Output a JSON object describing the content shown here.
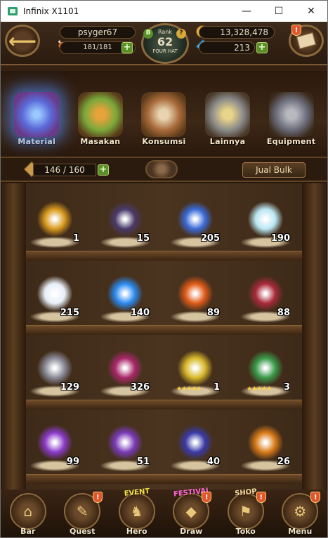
{
  "window": {
    "title": "Infinix X1101",
    "controls": [
      "—",
      "☐",
      "✕"
    ]
  },
  "hud": {
    "player_name": "psyger67",
    "stamina": "181/181",
    "rank_label": "Rank",
    "rank_value": "62",
    "rank_sub": "FOUR HAT",
    "gold": "13,328,478",
    "gems": "213",
    "mail_alert": "!"
  },
  "categories": [
    {
      "label": "Material",
      "active": true
    },
    {
      "label": "Masakan",
      "active": false
    },
    {
      "label": "Konsumsi",
      "active": false
    },
    {
      "label": "Lainnya",
      "active": false
    },
    {
      "label": "Equipment",
      "active": false
    }
  ],
  "capacity": {
    "value": "146 / 160",
    "bulk_sell_label": "Jual Bulk"
  },
  "items": [
    {
      "count": "1",
      "icon": "golden-orb-icon",
      "color": "#d99a1e"
    },
    {
      "count": "15",
      "icon": "dark-crystal-orb-icon",
      "color": "#4a3a6a"
    },
    {
      "count": "205",
      "icon": "potion-bottle-icon",
      "color": "#3a6ad8"
    },
    {
      "count": "190",
      "icon": "ice-crystal-icon",
      "color": "#b9e6f2"
    },
    {
      "count": "215",
      "icon": "white-crystal-icon",
      "color": "#e8eef8"
    },
    {
      "count": "140",
      "icon": "blue-flame-icon",
      "color": "#2a8af0"
    },
    {
      "count": "89",
      "icon": "fire-rune-icon",
      "color": "#e05a18"
    },
    {
      "count": "88",
      "icon": "red-crystal-shard-icon",
      "color": "#a82a3a"
    },
    {
      "count": "129",
      "icon": "grey-claw-icon",
      "color": "#8a8a98"
    },
    {
      "count": "326",
      "icon": "pink-horn-icon",
      "color": "#a8286a"
    },
    {
      "count": "1",
      "icon": "gold-tarot-card-icon",
      "color": "#d8b82a",
      "stars": "★★★★★"
    },
    {
      "count": "3",
      "icon": "green-tarot-card-icon",
      "color": "#3a9a4a",
      "stars": "★★★★★"
    },
    {
      "count": "99",
      "icon": "purple-mushroom-icon",
      "color": "#8a3ac8"
    },
    {
      "count": "51",
      "icon": "purple-mushroom-icon",
      "color": "#7a3ab8"
    },
    {
      "count": "40",
      "icon": "blue-shield-icon",
      "color": "#3a3aa8"
    },
    {
      "count": "26",
      "icon": "orange-shield-icon",
      "color": "#d87a18"
    }
  ],
  "nav": [
    {
      "label": "Bar",
      "icon": "bar-icon",
      "glyph": "⌂",
      "alert": false,
      "tag": ""
    },
    {
      "label": "Quest",
      "icon": "scroll-icon",
      "glyph": "✎",
      "alert": true,
      "tag": ""
    },
    {
      "label": "Hero",
      "icon": "helmet-icon",
      "glyph": "♞",
      "alert": false,
      "tag": "EVENT"
    },
    {
      "label": "Draw",
      "icon": "crystal-icon",
      "glyph": "◆",
      "alert": true,
      "tag": "FESTIVAL"
    },
    {
      "label": "Toko",
      "icon": "shop-icon",
      "glyph": "⚑",
      "alert": true,
      "tag": "SHOP"
    },
    {
      "label": "Menu",
      "icon": "wrench-icon",
      "glyph": "⚙",
      "alert": true,
      "tag": ""
    }
  ],
  "alert_glyph": "!"
}
